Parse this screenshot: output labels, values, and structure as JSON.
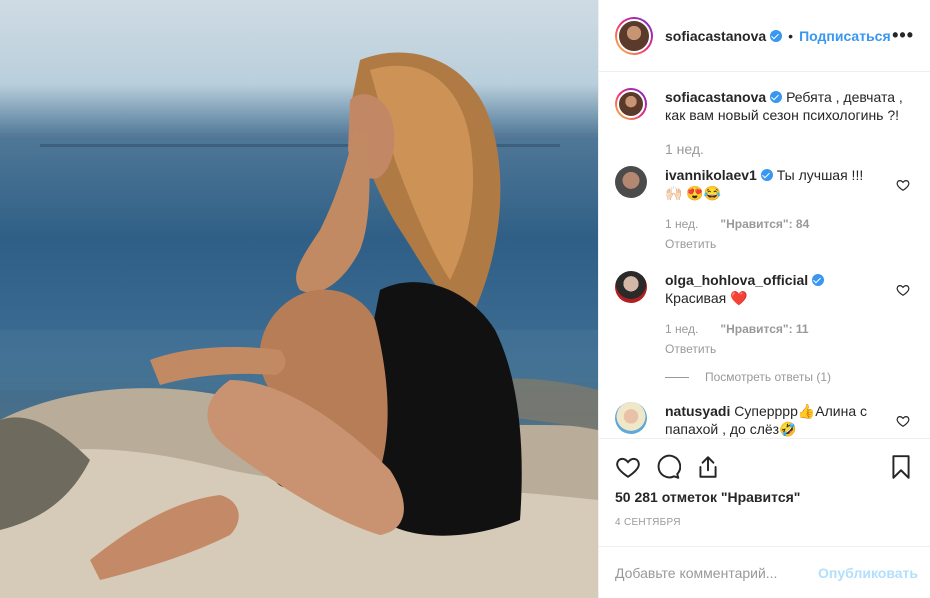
{
  "post": {
    "author": "sofiacastanova",
    "follow_label": "Подписаться",
    "dot": "•",
    "more_label": "•••",
    "caption": "Ребята , девчата , как вам новый сезон психологинь ?!",
    "caption_time": "1 нед."
  },
  "comments": [
    {
      "user": "ivannikolaev1",
      "text": "Ты лучшая !!! 🙌🏻 😍😂",
      "time": "1 нед.",
      "likes": "\"Нравится\": 84",
      "reply": "Ответить"
    },
    {
      "user": "olga_hohlova_official",
      "text": "Красивая ❤️",
      "time": "1 нед.",
      "likes": "\"Нравится\": 11",
      "reply": "Ответить",
      "view_replies": "Посмотреть ответы (1)"
    },
    {
      "user": "natusyadi",
      "text": "Суперррр👍Алина с папахой , до слёз🤣"
    }
  ],
  "actions": {
    "likes_count": "50 281 отметок \"Нравится\"",
    "date": "4 СЕНТЯБРЯ"
  },
  "composer": {
    "placeholder": "Добавьте комментарий...",
    "publish_label": "Опубликовать"
  },
  "colors": {
    "link": "#3897f0",
    "muted": "#999999",
    "publish_disabled": "#b2dffc",
    "heart_red": "#ed4956"
  }
}
